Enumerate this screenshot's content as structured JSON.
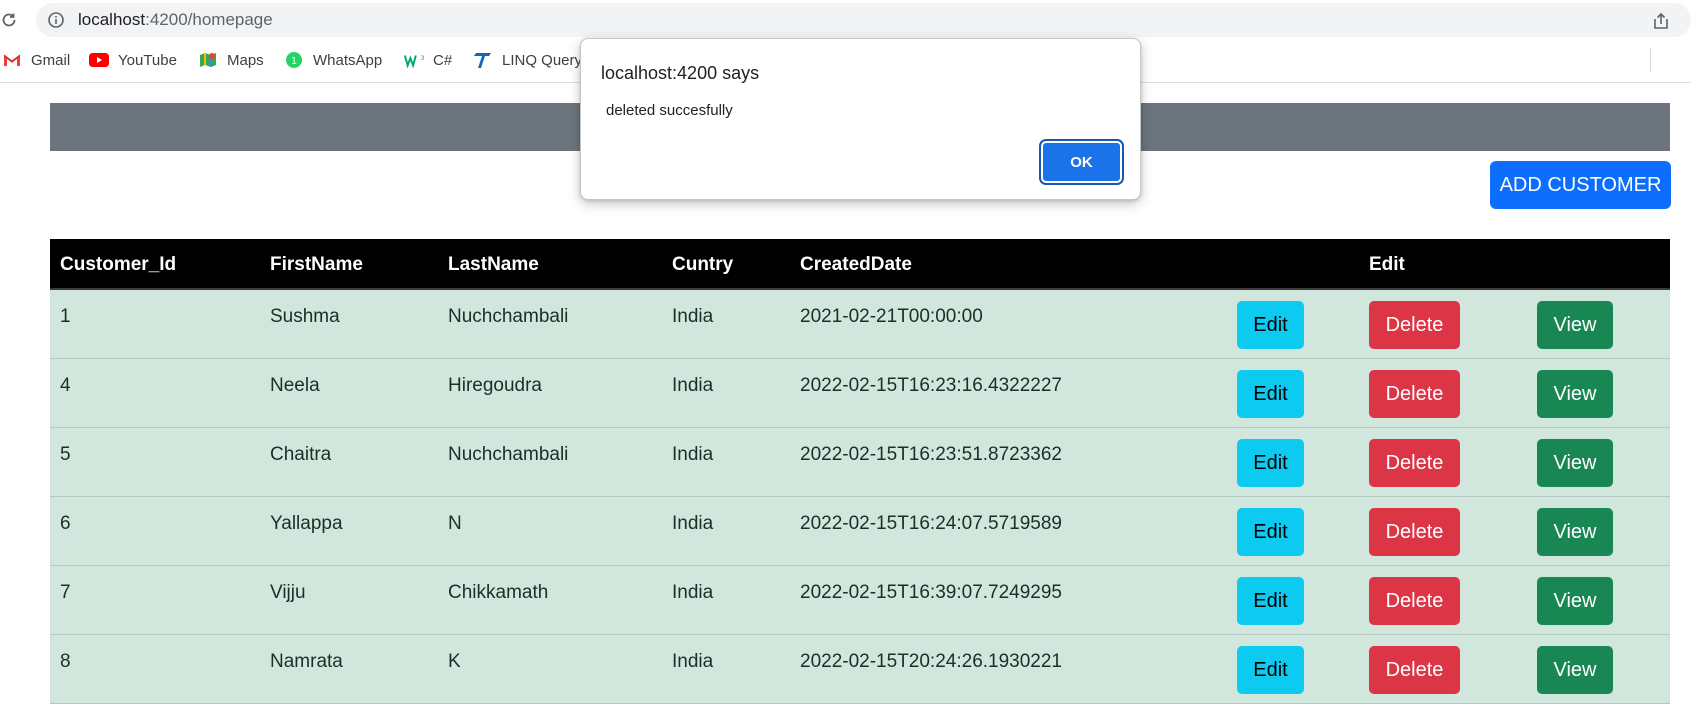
{
  "browser": {
    "url_host": "localhost",
    "url_rest": ":4200/homepage",
    "bookmarks": [
      {
        "label": "Gmail",
        "icon": "gmail-icon"
      },
      {
        "label": "YouTube",
        "icon": "youtube-icon"
      },
      {
        "label": "Maps",
        "icon": "maps-icon"
      },
      {
        "label": "WhatsApp",
        "icon": "whatsapp-icon"
      },
      {
        "label": "C#",
        "icon": "w3schools-icon"
      },
      {
        "label": "LINQ Query",
        "icon": "linq-icon"
      }
    ]
  },
  "page": {
    "add_button": "ADD CUSTOMER",
    "table": {
      "headers": [
        "Customer_Id",
        "FirstName",
        "LastName",
        "Cuntry",
        "CreatedDate",
        "Edit"
      ],
      "rows": [
        {
          "id": "1",
          "first": "Sushma",
          "last": "Nuchchambali",
          "country": "India",
          "created": "2021-02-21T00:00:00"
        },
        {
          "id": "4",
          "first": "Neela",
          "last": "Hiregoudra",
          "country": "India",
          "created": "2022-02-15T16:23:16.4322227"
        },
        {
          "id": "5",
          "first": "Chaitra",
          "last": "Nuchchambali",
          "country": "India",
          "created": "2022-02-15T16:23:51.8723362"
        },
        {
          "id": "6",
          "first": "Yallappa",
          "last": "N",
          "country": "India",
          "created": "2022-02-15T16:24:07.5719589"
        },
        {
          "id": "7",
          "first": "Vijju",
          "last": "Chikkamath",
          "country": "India",
          "created": "2022-02-15T16:39:07.7249295"
        },
        {
          "id": "8",
          "first": "Namrata",
          "last": "K",
          "country": "India",
          "created": "2022-02-15T20:24:26.1930221"
        }
      ],
      "edit_label": "Edit",
      "delete_label": "Delete",
      "view_label": "View"
    }
  },
  "dialog": {
    "title": "localhost:4200 says",
    "message": "deleted succesfully",
    "ok_label": "OK"
  },
  "colors": {
    "primary": "#0d6efd",
    "info": "#0dcaf0",
    "danger": "#dc3545",
    "success": "#198754",
    "row_bg": "#d1e7dd",
    "header_bar": "#6c757d"
  }
}
